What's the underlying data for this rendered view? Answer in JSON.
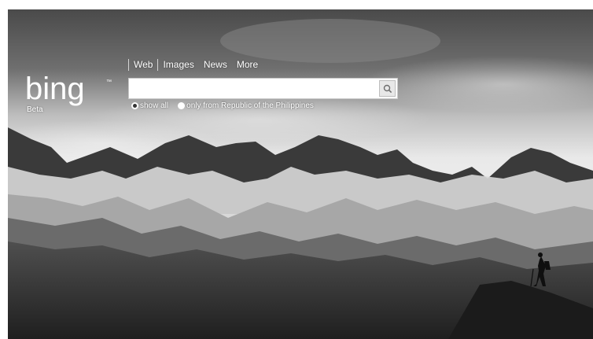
{
  "nav": {
    "items": [
      {
        "label": "Web"
      },
      {
        "label": "Images"
      },
      {
        "label": "News"
      },
      {
        "label": "More"
      }
    ]
  },
  "brand": {
    "logo_text": "bing",
    "beta": "Beta"
  },
  "search": {
    "value": "",
    "placeholder": "",
    "button_icon": "search-icon"
  },
  "scope": {
    "options": [
      {
        "label": "show all",
        "selected": true
      },
      {
        "label": "only from Republic of the Philippines",
        "selected": false
      }
    ]
  },
  "background": {
    "description_icon": "mountain-landscape-with-hiker"
  }
}
